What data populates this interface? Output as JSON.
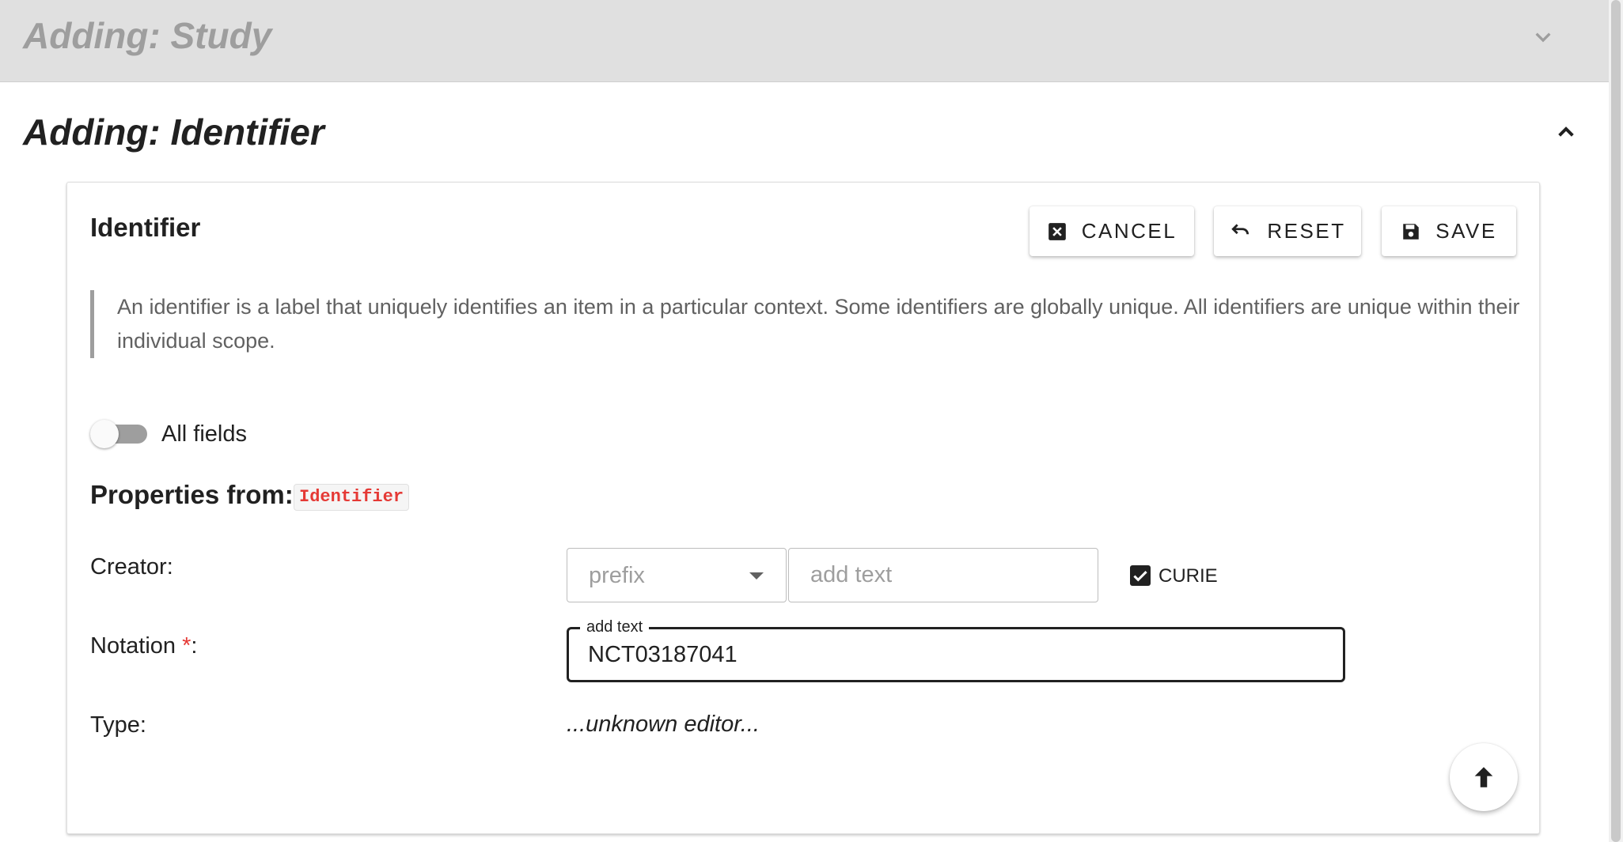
{
  "panels": {
    "study": {
      "title": "Adding: Study",
      "expand_icon": "chevron-down-icon"
    },
    "identifier": {
      "title": "Adding: Identifier",
      "collapse_icon": "chevron-up-icon"
    }
  },
  "card": {
    "title": "Identifier",
    "buttons": {
      "cancel": {
        "label": "CANCEL",
        "icon": "close-box-icon"
      },
      "reset": {
        "label": "RESET",
        "icon": "undo-icon"
      },
      "save": {
        "label": "SAVE",
        "icon": "floppy-disk-icon"
      }
    },
    "description": "An identifier is a label that uniquely identifies an item in a particular context. Some identifiers are globally unique. All identifiers are unique within their individual scope.",
    "all_fields_toggle": {
      "label": "All fields",
      "on": false
    },
    "properties": {
      "label": "Properties from:",
      "class_name": "Identifier"
    },
    "fields": {
      "creator": {
        "label": "Creator:",
        "prefix_placeholder": "prefix",
        "text_placeholder": "add text",
        "curie_label": "CURIE",
        "curie_checked": true
      },
      "notation": {
        "label": "Notation",
        "required_mark": "*",
        "label_suffix": ":",
        "legend": "add text",
        "value": "NCT03187041"
      },
      "type": {
        "label": "Type:",
        "value": "...unknown editor..."
      }
    },
    "scroll_top_icon": "arrow-up-icon"
  },
  "colors": {
    "accent_required": "#e53935",
    "chip_text": "#e53935",
    "study_header_bg": "#e0e0e0"
  }
}
